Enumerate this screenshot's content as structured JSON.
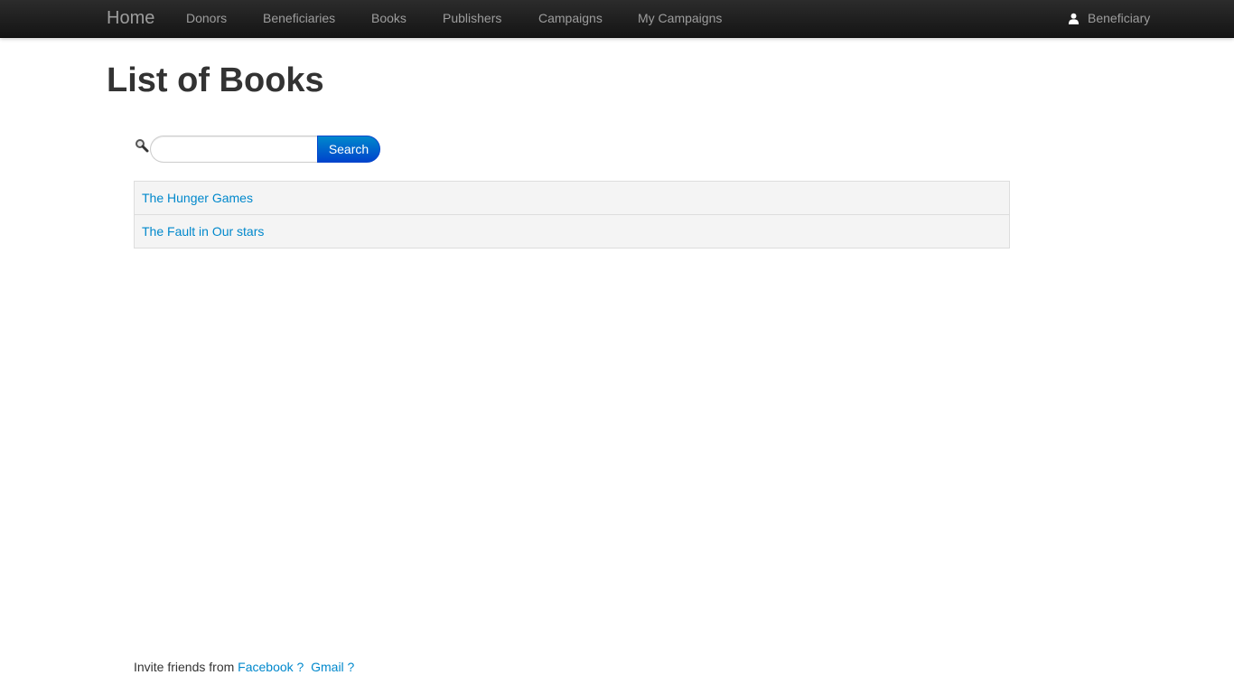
{
  "navbar": {
    "brand": "Home",
    "links": [
      "Donors",
      "Beneficiaries",
      "Books",
      "Publishers",
      "Campaigns",
      "My Campaigns"
    ],
    "user_label": "Beneficiary",
    "user_icon": "user-icon"
  },
  "page": {
    "title": "List of Books"
  },
  "search": {
    "placeholder": "",
    "value": "",
    "button_label": "Search",
    "icon": "search-icon"
  },
  "books": [
    {
      "title": "The Hunger Games"
    },
    {
      "title": "The Fault in Our stars"
    }
  ],
  "footer": {
    "text": "Invite friends from",
    "facebook_link": "Facebook ?",
    "gmail_link": "Gmail ?"
  },
  "colors": {
    "navbar_bg": "#1b1b1b",
    "nav_text": "#9d9d9d",
    "link": "#0088cc",
    "button": "#0055cc"
  }
}
